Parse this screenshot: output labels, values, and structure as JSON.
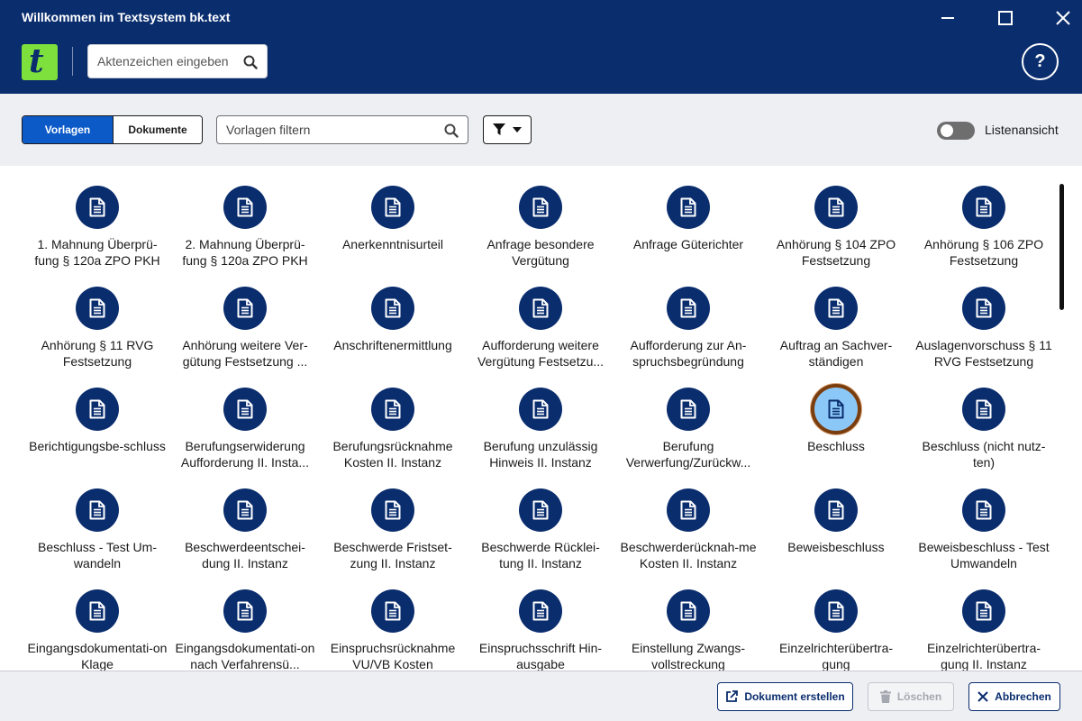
{
  "window": {
    "title": "Willkommen im Textsystem bk.text"
  },
  "header": {
    "logo_letter": "t",
    "aktenzeichen_placeholder": "Aktenzeichen eingeben",
    "help_label": "?"
  },
  "toolbar": {
    "tab_vorlagen": "Vorlagen",
    "tab_dokumente": "Dokumente",
    "active_tab": "Vorlagen",
    "filter_placeholder": "Vorlagen filtern",
    "list_view_label": "Listenansicht",
    "list_view_on": false
  },
  "colors": {
    "brand_navy": "#0a2d6e",
    "active_blue": "#0b5ac8",
    "logo_green": "#7ee03c",
    "selected_fill": "#8cc8f7",
    "selected_ring": "#7a3d0e"
  },
  "templates": [
    {
      "label": "1. Mahnung Überprü-fung § 120a ZPO PKH",
      "selected": false
    },
    {
      "label": "2. Mahnung Überprü-fung § 120a ZPO PKH",
      "selected": false
    },
    {
      "label": "Anerkenntnisurteil",
      "selected": false
    },
    {
      "label": "Anfrage besondere Vergütung",
      "selected": false
    },
    {
      "label": "Anfrage Güterichter",
      "selected": false
    },
    {
      "label": "Anhörung § 104 ZPO Festsetzung",
      "selected": false
    },
    {
      "label": "Anhörung § 106 ZPO Festsetzung",
      "selected": false
    },
    {
      "label": "Anhörung § 11 RVG Festsetzung",
      "selected": false
    },
    {
      "label": "Anhörung weitere Ver-gütung Festsetzung ...",
      "selected": false
    },
    {
      "label": "Anschriftenermittlung",
      "selected": false
    },
    {
      "label": "Aufforderung weitere Vergütung Festsetzu...",
      "selected": false
    },
    {
      "label": "Aufforderung zur An-spruchsbegründung",
      "selected": false
    },
    {
      "label": "Auftrag an Sachver-ständigen",
      "selected": false
    },
    {
      "label": "Auslagenvorschuss § 11 RVG Festsetzung",
      "selected": false
    },
    {
      "label": "Berichtigungsbe-schluss",
      "selected": false
    },
    {
      "label": "Berufungserwiderung Aufforderung II. Insta...",
      "selected": false
    },
    {
      "label": "Berufungsrücknahme Kosten II. Instanz",
      "selected": false
    },
    {
      "label": "Berufung unzulässig Hinweis II. Instanz",
      "selected": false
    },
    {
      "label": "Berufung Verwerfung/Zurückw...",
      "selected": false
    },
    {
      "label": "Beschluss",
      "selected": true
    },
    {
      "label": "Beschluss (nicht nutz-ten)",
      "selected": false
    },
    {
      "label": "Beschluss - Test Um-wandeln",
      "selected": false
    },
    {
      "label": "Beschwerdeentschei-dung II. Instanz",
      "selected": false
    },
    {
      "label": "Beschwerde Fristset-zung II. Instanz",
      "selected": false
    },
    {
      "label": "Beschwerde Rücklei-tung II. Instanz",
      "selected": false
    },
    {
      "label": "Beschwerderücknah-me Kosten II. Instanz",
      "selected": false
    },
    {
      "label": "Beweisbeschluss",
      "selected": false
    },
    {
      "label": "Beweisbeschluss - Test Umwandeln",
      "selected": false
    },
    {
      "label": "Eingangsdokumentati-on Klage",
      "selected": false
    },
    {
      "label": "Eingangsdokumentati-on nach Verfahrensü...",
      "selected": false
    },
    {
      "label": "Einspruchsrücknahme VU/VB Kosten",
      "selected": false
    },
    {
      "label": "Einspruchsschrift Hin-ausgabe",
      "selected": false
    },
    {
      "label": "Einstellung Zwangs-vollstreckung",
      "selected": false
    },
    {
      "label": "Einzelrichterübertra-gung",
      "selected": false
    },
    {
      "label": "Einzelrichterübertra-gung II. Instanz",
      "selected": false
    }
  ],
  "footer": {
    "create_label": "Dokument erstellen",
    "delete_label": "Löschen",
    "delete_enabled": false,
    "cancel_label": "Abbrechen"
  }
}
